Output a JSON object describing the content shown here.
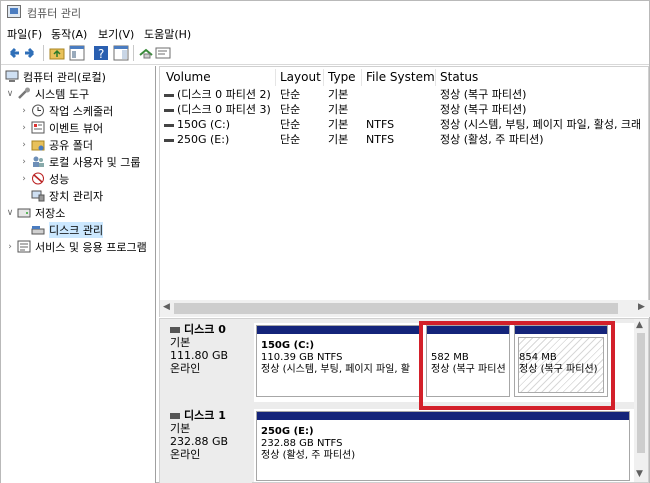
{
  "window": {
    "title": "컴퓨터 관리"
  },
  "menu": [
    "파일(F)",
    "동작(A)",
    "보기(V)",
    "도움말(H)"
  ],
  "toolbar": {
    "icons": [
      "back-arrow-icon",
      "forward-arrow-icon",
      "folder-up-icon",
      "properties-icon",
      "help-icon",
      "panel-icon",
      "connect-icon",
      "console-icon"
    ]
  },
  "tree": {
    "root": "컴퓨터 관리(로컬)",
    "system_tools": "시스템 도구",
    "task_scheduler": "작업 스케줄러",
    "event_viewer": "이벤트 뷰어",
    "shared_folders": "공유 폴더",
    "local_users": "로컬 사용자 및 그룹",
    "performance": "성능",
    "device_manager": "장치 관리자",
    "storage": "저장소",
    "disk_management": "디스크 관리",
    "services": "서비스 및 응용 프로그램"
  },
  "volume_list": {
    "columns": [
      "Volume",
      "Layout",
      "Type",
      "File System",
      "Status"
    ],
    "rows": [
      {
        "volume": "(디스크 0 파티션 2)",
        "layout": "단순",
        "type": "기본",
        "fs": "",
        "status": "정상 (복구 파티션)"
      },
      {
        "volume": "(디스크 0 파티션 3)",
        "layout": "단순",
        "type": "기본",
        "fs": "",
        "status": "정상 (복구 파티션)"
      },
      {
        "volume": "150G (C:)",
        "layout": "단순",
        "type": "기본",
        "fs": "NTFS",
        "status": "정상 (시스템, 부팅, 페이지 파일, 활성, 크래"
      },
      {
        "volume": "250G (E:)",
        "layout": "단순",
        "type": "기본",
        "fs": "NTFS",
        "status": "정상 (활성, 주 파티션)"
      }
    ]
  },
  "disks": [
    {
      "name": "디스크 0",
      "kind": "기본",
      "size": "111.80 GB",
      "state": "온라인",
      "partitions": [
        {
          "title": "150G  (C:)",
          "size": "110.39 GB NTFS",
          "status": "정상 (시스템, 부팅, 페이지 파일, 활"
        },
        {
          "title": "",
          "size": "582 MB",
          "status": "정상 (복구 파티션"
        },
        {
          "title": "",
          "size": "854 MB",
          "status": "정상 (복구 파티션)"
        }
      ]
    },
    {
      "name": "디스크 1",
      "kind": "기본",
      "size": "232.88 GB",
      "state": "온라인",
      "partitions": [
        {
          "title": "250G  (E:)",
          "size": "232.88 GB NTFS",
          "status": "정상 (활성, 주 파티션)"
        }
      ]
    }
  ],
  "colors": {
    "partition_bar": "#14247a",
    "highlight": "#d3202a",
    "selection": "#cce8ff"
  }
}
